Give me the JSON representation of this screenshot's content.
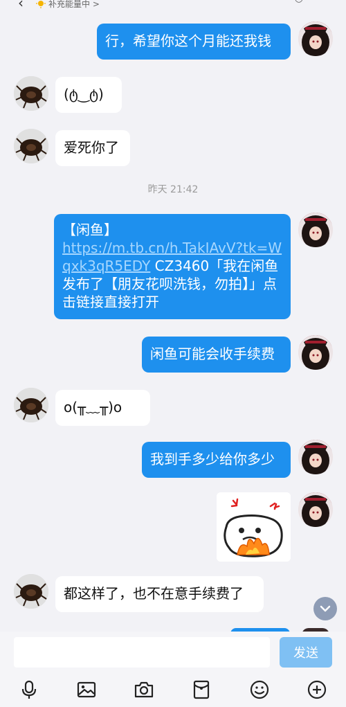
{
  "header": {
    "status_text": "补充能量中 >"
  },
  "messages": {
    "m1": "行，希望你这个月能还我钱",
    "m2": "(ტ‿ტ)",
    "m3": "爱死你了",
    "timestamp": "昨天 21:42",
    "m4_prefix": "【闲鱼】",
    "m4_link": "https://m.tb.cn/h.TakIAvV?tk=Wqxk3qR5EDY",
    "m4_suffix": " CZ3460「我在闲鱼发布了【朋友花呗洗钱，勿拍】」点击链接直接打开",
    "m5": "闲鱼可能会收手续费",
    "m6": "o(╥﹏╥)o",
    "m7": "我到手多少给你多少",
    "m9": "都这样了，也不在意手续费了"
  },
  "composer": {
    "placeholder": "",
    "send_label": "发送"
  },
  "icons": [
    "microphone-icon",
    "image-icon",
    "camera-icon",
    "red-packet-icon",
    "emoji-icon",
    "plus-icon"
  ],
  "colors": {
    "outgoing_bubble": "#1e90ee",
    "incoming_bubble": "#ffffff",
    "background": "#f2f2f6",
    "send_button": "#7fc0f3"
  }
}
